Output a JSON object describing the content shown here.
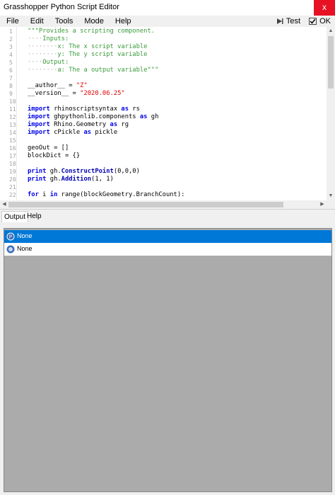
{
  "window": {
    "title": "Grasshopper Python Script Editor",
    "close_label": "x"
  },
  "menu": {
    "items": [
      "File",
      "Edit",
      "Tools",
      "Mode",
      "Help"
    ]
  },
  "toolbar": {
    "test_label": "Test",
    "ok_label": "OK"
  },
  "editor": {
    "lines": [
      "\"\"\"Provides a scripting component.",
      "····Inputs:",
      "········x: The x script variable",
      "········y: The y script variable",
      "····Output:",
      "········a: The a output variable\"\"\"",
      "",
      "__author__ = \"Z\"",
      "__version__ = \"2020.06.25\"",
      "",
      "import rhinoscriptsyntax as rs",
      "import ghpythonlib.components as gh",
      "import Rhino.Geometry as rg",
      "import cPickle as pickle",
      "",
      "geoOut = []",
      "blockDict = {}",
      "",
      "print gh.ConstructPoint(0,0,0)",
      "print gh.Addition(1, 1)",
      "",
      "for i in range(blockGeometry.BranchCount):"
    ]
  },
  "tabs": [
    "Output",
    "Help"
  ],
  "output": {
    "rows": [
      "None",
      "None"
    ]
  }
}
